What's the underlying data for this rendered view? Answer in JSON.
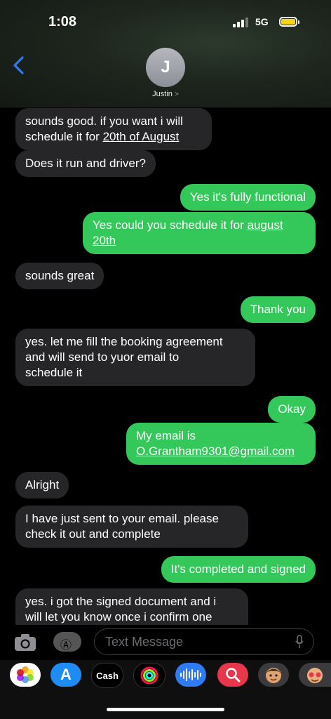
{
  "status": {
    "time": "1:08",
    "network": "5G"
  },
  "contact": {
    "initial": "J",
    "name": "Justin",
    "chevron": ">"
  },
  "messages": [
    {
      "dir": "in",
      "lines": [
        "sounds good. if you want i will",
        "schedule it for "
      ],
      "link": "20th of August"
    },
    {
      "dir": "in",
      "text": "Does it run and driver?"
    },
    {
      "dir": "out",
      "text": "Yes it's fully functional"
    },
    {
      "dir": "out",
      "text": "Yes could you schedule it for ",
      "link1": "august",
      "link2": "20th"
    },
    {
      "dir": "in",
      "text": "sounds great"
    },
    {
      "dir": "out",
      "text": "Thank you"
    },
    {
      "dir": "in",
      "lines": [
        "yes. let me fill the booking agreement",
        "and will send to yuor email to",
        "schedule it"
      ]
    },
    {
      "dir": "out",
      "text": "Okay"
    },
    {
      "dir": "out",
      "text": "My email is",
      "link": "O.Grantham9301@gmail.com"
    },
    {
      "dir": "in",
      "text": "Alright"
    },
    {
      "dir": "in",
      "lines": [
        "I have just sent to your email. please",
        "check it out and complete"
      ]
    },
    {
      "dir": "out",
      "text": "It's completed and signed"
    },
    {
      "dir": "in",
      "lines": [
        "yes. i got the signed document and i",
        "will let you know once i confirm one"
      ]
    }
  ],
  "compose": {
    "placeholder": "Text Message"
  },
  "apps": {
    "cash_label": "Cash",
    "items": [
      "photos-icon",
      "app-store-icon",
      "apple-cash-icon",
      "activity-icon",
      "audio-icon",
      "search-images-icon",
      "memoji-icon",
      "memoji-stickers-icon"
    ]
  },
  "colors": {
    "outgoing": "#34c759",
    "incoming": "#262628",
    "back_arrow": "#2f7bf6"
  }
}
